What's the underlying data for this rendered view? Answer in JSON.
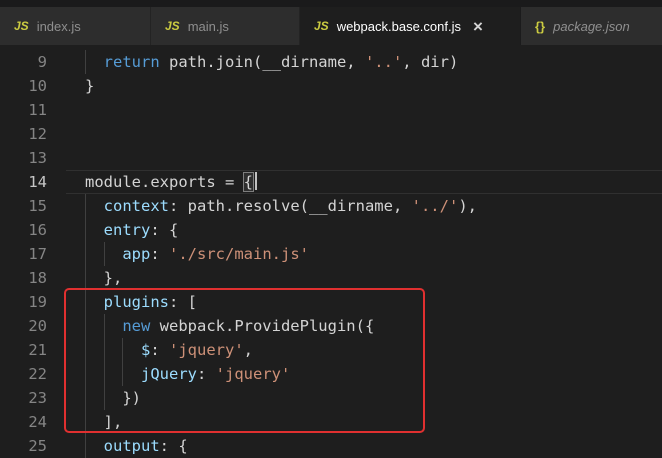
{
  "tabs": [
    {
      "label": "index.js",
      "icon_text": "JS",
      "active": false,
      "preview": false
    },
    {
      "label": "main.js",
      "icon_text": "JS",
      "active": false,
      "preview": false
    },
    {
      "label": "webpack.base.conf.js",
      "icon_text": "JS",
      "active": true,
      "preview": false,
      "close_label": "×"
    },
    {
      "label": "package.json",
      "icon_text": "{}",
      "active": false,
      "preview": true
    }
  ],
  "colors": {
    "editor_background": "#1e1e1e",
    "inactive_tab_background": "#2d2d2d",
    "active_tab_background": "#1e1e1e",
    "keyword": "#569cd6",
    "property": "#9cdcfe",
    "string": "#ce9178",
    "default_text": "#d4d4d4",
    "line_number": "#858585",
    "active_line_number": "#c6c6c6",
    "file_icon_yellow": "#cbcb41",
    "annotation_red": "#e03030"
  },
  "editor": {
    "lines": [
      {
        "num": 9,
        "indent": 2,
        "tokens": [
          {
            "t": "return ",
            "c": "k"
          },
          {
            "t": "path.join(__dirname, ",
            "c": "d"
          },
          {
            "t": "'..'",
            "c": "s"
          },
          {
            "t": ", dir)",
            "c": "d"
          }
        ]
      },
      {
        "num": 10,
        "indent": 0,
        "tokens": [
          {
            "t": "}",
            "c": "d"
          }
        ]
      },
      {
        "num": 11,
        "indent": 0,
        "tokens": []
      },
      {
        "num": 12,
        "indent": 0,
        "tokens": []
      },
      {
        "num": 13,
        "indent": 0,
        "tokens": []
      },
      {
        "num": 14,
        "indent": 0,
        "current": true,
        "tokens": [
          {
            "t": "module.exports = ",
            "c": "d"
          },
          {
            "t": "{",
            "c": "d",
            "hl": true
          },
          {
            "t": "",
            "c": "cursor"
          }
        ]
      },
      {
        "num": 15,
        "indent": 2,
        "tokens": [
          {
            "t": "context",
            "c": "p"
          },
          {
            "t": ": path.resolve(__dirname, ",
            "c": "d"
          },
          {
            "t": "'../'",
            "c": "s"
          },
          {
            "t": "),",
            "c": "d"
          }
        ]
      },
      {
        "num": 16,
        "indent": 2,
        "tokens": [
          {
            "t": "entry",
            "c": "p"
          },
          {
            "t": ": {",
            "c": "d"
          }
        ]
      },
      {
        "num": 17,
        "indent": 4,
        "tokens": [
          {
            "t": "app",
            "c": "p"
          },
          {
            "t": ": ",
            "c": "d"
          },
          {
            "t": "'./src/main.js'",
            "c": "s"
          }
        ]
      },
      {
        "num": 18,
        "indent": 2,
        "tokens": [
          {
            "t": "},",
            "c": "d"
          }
        ]
      },
      {
        "num": 19,
        "indent": 2,
        "tokens": [
          {
            "t": "plugins",
            "c": "p"
          },
          {
            "t": ": [",
            "c": "d"
          }
        ]
      },
      {
        "num": 20,
        "indent": 4,
        "tokens": [
          {
            "t": "new",
            "c": "k"
          },
          {
            "t": " webpack.ProvidePlugin({",
            "c": "d"
          }
        ]
      },
      {
        "num": 21,
        "indent": 6,
        "tokens": [
          {
            "t": "$",
            "c": "p"
          },
          {
            "t": ": ",
            "c": "d"
          },
          {
            "t": "'jquery'",
            "c": "s"
          },
          {
            "t": ",",
            "c": "d"
          }
        ]
      },
      {
        "num": 22,
        "indent": 6,
        "tokens": [
          {
            "t": "jQuery",
            "c": "p"
          },
          {
            "t": ": ",
            "c": "d"
          },
          {
            "t": "'jquery'",
            "c": "s"
          }
        ]
      },
      {
        "num": 23,
        "indent": 4,
        "tokens": [
          {
            "t": "})",
            "c": "d"
          }
        ]
      },
      {
        "num": 24,
        "indent": 2,
        "tokens": [
          {
            "t": "],",
            "c": "d"
          }
        ]
      },
      {
        "num": 25,
        "indent": 2,
        "tokens": [
          {
            "t": "output",
            "c": "p"
          },
          {
            "t": ": {",
            "c": "d"
          }
        ]
      }
    ]
  },
  "annotation": {
    "color": "#e03030"
  }
}
